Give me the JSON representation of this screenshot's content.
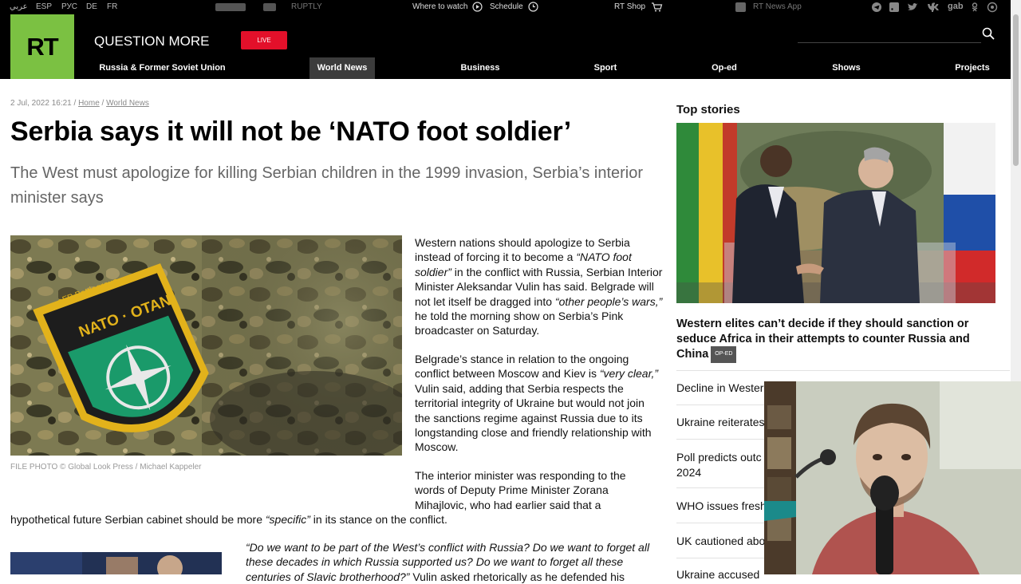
{
  "topbar": {
    "languages": [
      "عربي",
      "ESP",
      "РУС",
      "DE",
      "FR"
    ],
    "partners": [
      "RUPTLY"
    ],
    "where_to_watch": "Where to watch",
    "schedule": "Schedule",
    "shop": "RT Shop",
    "news_app": "RT News App",
    "social_gab": "gab"
  },
  "header": {
    "logo": "RT",
    "slogan": "QUESTION MORE",
    "live": "LIVE",
    "nav": [
      {
        "label": "Russia & Former Soviet Union"
      },
      {
        "label": "World News"
      },
      {
        "label": "Business"
      },
      {
        "label": "Sport"
      },
      {
        "label": "Op-ed"
      },
      {
        "label": "Shows"
      },
      {
        "label": "Projects"
      }
    ],
    "active_tab": "World News"
  },
  "article": {
    "date": "2 Jul, 2022 16:21",
    "sep": "/",
    "breadcrumb_home": "Home",
    "breadcrumb_section": "World News",
    "title": "Serbia says it will not be ‘NATO foot soldier’",
    "subtitle": "The West must apologize for killing Serbian children in the 1999 invasion, Serbia’s interior minister says",
    "image_caption": "FILE PHOTO  ©  Global Look Press / Michael Kappeler",
    "patch_top": "eFP Battlegroup",
    "patch_main": "NATO · OTAN",
    "p1": {
      "a": "Western nations should apologize to Serbia instead of forcing it to become a ",
      "b": "“NATO foot soldier”",
      "c": " in the conflict with Russia, Serbian Interior Minister Aleksandar Vulin has said. Belgrade will not let itself be dragged into ",
      "d": "“other people’s wars,”",
      "e": " he told the morning show on Serbia’s Pink broadcaster on Saturday."
    },
    "p2": {
      "a": "Belgrade’s stance in relation to the ongoing conflict between Moscow and Kiev is ",
      "b": "“very clear,”",
      "c": " Vulin said, adding that Serbia respects the territorial integrity of Ukraine but would not join the sanctions regime against Russia due to its longstanding close and friendly relationship with Moscow."
    },
    "p3": {
      "line1": "The interior minister was responding to the",
      "line2": "words of Deputy Prime Minister Zorana",
      "line3": "Mihajlovic, who had earlier said that a",
      "line4_a": "hypothetical future Serbian cabinet should be more ",
      "line4_b": "“specific”",
      "line4_c": " in its stance on the conflict."
    },
    "p4": {
      "line1": "“Do we want to be part of the West’s conflict with Russia? Do we want to forget all",
      "line2": "these decades in which Russia supported us? Do we want to forget all these",
      "line3_a": "centuries of Slavic brotherhood?”",
      "line3_b": " Vulin asked rhetorically as he defended his"
    }
  },
  "sidebar": {
    "heading": "Top stories",
    "lead_title": "Western elites can’t decide if they should sanction or seduce Africa in their attempts to counter Russia and China",
    "lead_badge": "OP-ED",
    "items": [
      "Decline in Western",
      "Ukraine reiterates",
      "Poll predicts outc",
      "2024",
      "WHO issues fresh",
      "UK cautioned abo",
      "Ukraine accused"
    ]
  },
  "colors": {
    "brand_green": "#7bc142",
    "live_red": "#e3102a",
    "header_bg": "#000000"
  }
}
